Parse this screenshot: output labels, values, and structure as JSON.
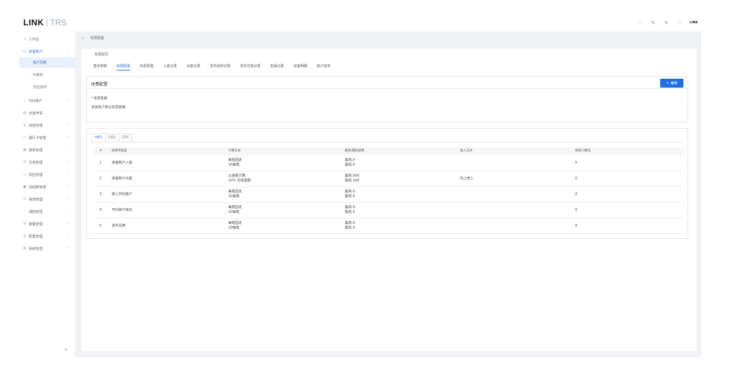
{
  "header": {
    "logo_main": "LINK",
    "logo_sep": "|",
    "logo_sub": "TRS",
    "icons": [
      "bell-icon",
      "translate-icon",
      "settings-icon",
      "fullscreen-icon"
    ],
    "brand": "LINK"
  },
  "sidebar": {
    "items": [
      {
        "label": "工作台",
        "icon": "home-icon"
      },
      {
        "label": "资金账户",
        "icon": "wallet-icon"
      },
      {
        "label": "TRS账户",
        "icon": "account-icon"
      },
      {
        "label": "资金申请",
        "icon": "apply-icon"
      },
      {
        "label": "资金管理",
        "icon": "fund-icon"
      },
      {
        "label": "银行卡管理",
        "icon": "card-icon"
      },
      {
        "label": "报表管理",
        "icon": "report-icon"
      },
      {
        "label": "交易管理",
        "icon": "trade-icon"
      },
      {
        "label": "风控管理",
        "icon": "shield-icon"
      },
      {
        "label": "清结算管理",
        "icon": "settle-icon"
      },
      {
        "label": "渠道管理",
        "icon": "channel-icon"
      },
      {
        "label": "通知管理",
        "icon": "notice-icon"
      },
      {
        "label": "套餐管理",
        "icon": "package-icon"
      },
      {
        "label": "配置管理",
        "icon": "config-icon"
      },
      {
        "label": "系统管理",
        "icon": "system-icon"
      }
    ],
    "sub_items": [
      "账户列表",
      "PI审核",
      "风险测评"
    ]
  },
  "breadcrumb": {
    "current": "收费配置"
  },
  "page": {
    "back_title": "收费配页",
    "tabs": [
      "基本参数",
      "收费配置",
      "利息配置",
      "入金记录",
      "出金记录",
      "货币划转记录",
      "货币兑换记录",
      "担保记录",
      "资金明细",
      "账户结单"
    ],
    "active_tab": 1
  },
  "fee_config": {
    "title": "收费配置",
    "edit_label": "编辑",
    "field_label": "收费套餐",
    "required_mark": "*",
    "field_value": "资金账户默认收费套餐"
  },
  "currency_tabs": [
    "HKD",
    "USD",
    "CNY"
  ],
  "table": {
    "headers": [
      "#",
      "收费项类型",
      "计算方式",
      "最高/最低收费",
      "舍入方式",
      "保留小数位"
    ],
    "rows": [
      {
        "no": "1",
        "type": "资金账户入金",
        "calc1": "每笔固定",
        "calc2": "10每笔",
        "limit1": "最高:0",
        "limit2": "最低:0",
        "round": "",
        "decimals": "0"
      },
      {
        "no": "2",
        "type": "资金账户出金",
        "calc1": "以金额计算",
        "calc2": "10% 交易金额",
        "limit1": "最高:500",
        "limit2": "最低:100",
        "round": "向上舍入",
        "decimals": "0"
      },
      {
        "no": "3",
        "type": "转入TRS账户",
        "calc1": "每笔固定",
        "calc2": "10每笔",
        "limit1": "最高:0",
        "limit2": "最低:0",
        "round": "",
        "decimals": "0"
      },
      {
        "no": "4",
        "type": "TRS账户转出",
        "calc1": "每笔固定",
        "calc2": "10每笔",
        "limit1": "最高:0",
        "limit2": "最低:0",
        "round": "",
        "decimals": "0"
      },
      {
        "no": "5",
        "type": "货币兑换",
        "calc1": "每笔固定",
        "calc2": "10每笔",
        "limit1": "最高:0",
        "limit2": "最低:0",
        "round": "",
        "decimals": "0"
      }
    ]
  }
}
